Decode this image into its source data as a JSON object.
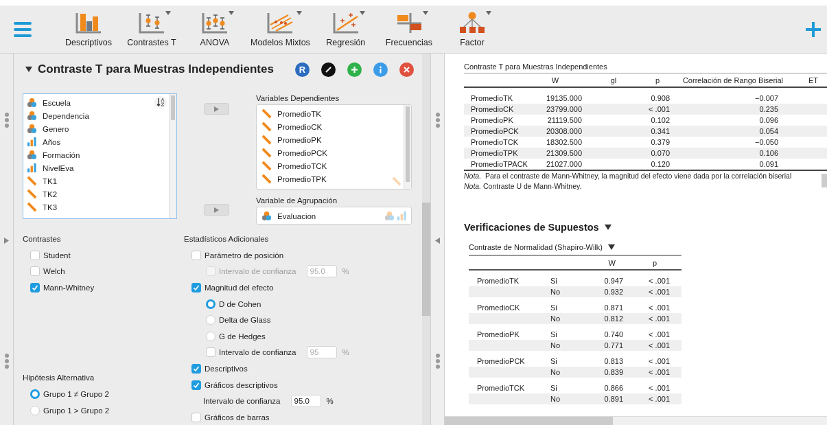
{
  "toolbar": {
    "modules": [
      {
        "label": "Descriptivos",
        "dropdown": false
      },
      {
        "label": "Contrastes T",
        "dropdown": true
      },
      {
        "label": "ANOVA",
        "dropdown": true
      },
      {
        "label": "Modelos Mixtos",
        "dropdown": true
      },
      {
        "label": "Regresión",
        "dropdown": true
      },
      {
        "label": "Frecuencias",
        "dropdown": true
      },
      {
        "label": "Factor",
        "dropdown": true
      }
    ]
  },
  "analysis": {
    "title": "Contraste T para Muestras Independientes",
    "expanded": true,
    "header_buttons": [
      {
        "kind": "r",
        "label": "R"
      },
      {
        "kind": "edit"
      },
      {
        "kind": "add"
      },
      {
        "kind": "info"
      },
      {
        "kind": "close"
      }
    ],
    "variables": [
      {
        "name": "Escuela",
        "kind": "nominal"
      },
      {
        "name": "Dependencia",
        "kind": "nominal"
      },
      {
        "name": "Genero",
        "kind": "nominal"
      },
      {
        "name": "Años",
        "kind": "ordinal"
      },
      {
        "name": "Formación",
        "kind": "nominal"
      },
      {
        "name": "NivelEva",
        "kind": "ordinal"
      },
      {
        "name": "TK1",
        "kind": "scale"
      },
      {
        "name": "TK2",
        "kind": "scale"
      },
      {
        "name": "TK3",
        "kind": "scale"
      }
    ],
    "dependent": {
      "label": "Variables Dependientes",
      "variables": [
        {
          "name": "PromedioTK",
          "kind": "scale"
        },
        {
          "name": "PromedioCK",
          "kind": "scale"
        },
        {
          "name": "PromedioPK",
          "kind": "scale"
        },
        {
          "name": "PromedioPCK",
          "kind": "scale"
        },
        {
          "name": "PromedioTCK",
          "kind": "scale"
        },
        {
          "name": "PromedioTPK",
          "kind": "scale"
        }
      ]
    },
    "grouping": {
      "label": "Variable de Agrupación",
      "variables": [
        {
          "name": "Evaluacion",
          "kind": "nominal"
        }
      ]
    },
    "contrasts": {
      "label": "Contrastes",
      "options": [
        {
          "label": "Student",
          "checked": false
        },
        {
          "label": "Welch",
          "checked": false
        },
        {
          "label": "Mann-Whitney",
          "checked": true
        }
      ]
    },
    "hypothesis": {
      "label": "Hipótesis Alternativa",
      "options": [
        {
          "label": "Grupo 1 ≠ Grupo 2",
          "selected": true
        },
        {
          "label": "Grupo 1 > Grupo 2",
          "selected": false
        }
      ]
    },
    "additional": {
      "label": "Estadísticos Adicionales",
      "items": [
        {
          "kind": "checkbox",
          "label": "Parámetro de posición",
          "checked": false,
          "disabled": false,
          "children": [
            {
              "kind": "checkbox",
              "label": "Intervalo de confianza",
              "checked": false,
              "disabled": true,
              "value": "95.0",
              "unit": "%"
            }
          ]
        },
        {
          "kind": "checkbox",
          "label": "Magnitud del efecto",
          "checked": true,
          "disabled": false,
          "children": [
            {
              "kind": "radio",
              "label": "D de Cohen",
              "selected": true
            },
            {
              "kind": "radio",
              "label": "Delta de Glass",
              "selected": false
            },
            {
              "kind": "radio",
              "label": "G de Hedges",
              "selected": false
            },
            {
              "kind": "checkbox",
              "label": "Intervalo de confianza",
              "checked": false,
              "disabled": false,
              "value": "95",
              "unit": "%"
            }
          ]
        },
        {
          "kind": "checkbox",
          "label": "Descriptivos",
          "checked": true,
          "disabled": false
        },
        {
          "kind": "checkbox",
          "label": "Gráficos descriptivos",
          "checked": true,
          "disabled": false,
          "children": [
            {
              "kind": "field",
              "label": "Intervalo de confianza",
              "disabled": false,
              "value": "95.0",
              "unit": "%"
            }
          ]
        },
        {
          "kind": "checkbox",
          "label": "Gráficos de barras",
          "checked": false,
          "disabled": false
        }
      ]
    }
  },
  "results": {
    "table": {
      "title": "Contraste T para Muestras Independientes",
      "columns": [
        "W",
        "gl",
        "p",
        "Correlación de Rango Biserial",
        "ET"
      ],
      "rows": [
        {
          "name": "PromedioTK",
          "w": "19135.000",
          "p": "0.908",
          "rank_biserial": "−0.007"
        },
        {
          "name": "PromedioCK",
          "w": "23799.000",
          "p": "< .001",
          "rank_biserial": "0.235"
        },
        {
          "name": "PromedioPK",
          "w": "21119.500",
          "p": "0.102",
          "rank_biserial": "0.096"
        },
        {
          "name": "PromedioPCK",
          "w": "20308.000",
          "p": "0.341",
          "rank_biserial": "0.054"
        },
        {
          "name": "PromedioTCK",
          "w": "18302.500",
          "p": "0.379",
          "rank_biserial": "−0.050"
        },
        {
          "name": "PromedioTPK",
          "w": "21309.500",
          "p": "0.070",
          "rank_biserial": "0.106"
        },
        {
          "name": "PromedioTPACK",
          "w": "21027.000",
          "p": "0.120",
          "rank_biserial": "0.091"
        }
      ],
      "notes": [
        "*Nota.*  Para el contraste de Mann-Whitney, la magnitud del efecto viene dada por la correlación biserial",
        "*Nota.* Contraste U de Mann-Whitney."
      ]
    },
    "assumptions": {
      "title": "Verificaciones de Supuestos",
      "expanded": true,
      "normality": {
        "title": "Contraste de Normalidad (Shapiro-Wilk)",
        "expanded": true,
        "columns": [
          "W",
          "p"
        ],
        "groups": [
          {
            "variable": "PromedioTK",
            "rows": [
              {
                "group": "Si",
                "w": "0.947",
                "p": "< .001"
              },
              {
                "group": "No",
                "w": "0.932",
                "p": "< .001"
              }
            ]
          },
          {
            "variable": "PromedioCK",
            "rows": [
              {
                "group": "Si",
                "w": "0.871",
                "p": "< .001"
              },
              {
                "group": "No",
                "w": "0.812",
                "p": "< .001"
              }
            ]
          },
          {
            "variable": "PromedioPK",
            "rows": [
              {
                "group": "Si",
                "w": "0.740",
                "p": "< .001"
              },
              {
                "group": "No",
                "w": "0.771",
                "p": "< .001"
              }
            ]
          },
          {
            "variable": "PromedioPCK",
            "rows": [
              {
                "group": "Si",
                "w": "0.813",
                "p": "< .001"
              },
              {
                "group": "No",
                "w": "0.839",
                "p": "< .001"
              }
            ]
          },
          {
            "variable": "PromedioTCK",
            "rows": [
              {
                "group": "Si",
                "w": "0.866",
                "p": "< .001"
              },
              {
                "group": "No",
                "w": "0.891",
                "p": "< .001"
              }
            ]
          }
        ]
      }
    }
  }
}
